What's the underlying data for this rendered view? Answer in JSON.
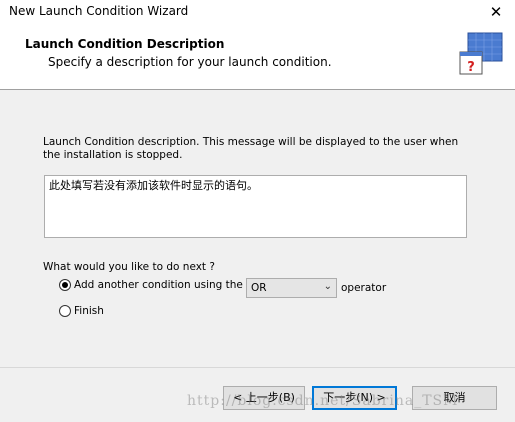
{
  "window": {
    "title": "New Launch Condition Wizard",
    "close_glyph": "✕"
  },
  "header": {
    "title": "Launch Condition Description",
    "subtitle": "Specify a description for your launch condition.",
    "icon": "wizard-help-icon"
  },
  "description": {
    "label": "Launch Condition description. This message will be displayed to the user when the installation is stopped.",
    "value": "此处填写若没有添加该软件时显示的语句。"
  },
  "next_step": {
    "label": "What would you like to do next ?",
    "options": [
      {
        "label": "Add another condition using the",
        "selected": true
      },
      {
        "label": "Finish",
        "selected": false
      }
    ],
    "operator": {
      "value": "OR",
      "suffix": "operator"
    }
  },
  "buttons": {
    "back": "< 上一步(B)",
    "next": "下一步(N) >",
    "cancel": "取消"
  },
  "watermark": "http://blog.csdn.net/Sabrina_TSM",
  "colors": {
    "accent": "#0078d7",
    "icon_blue": "#4a7bd0",
    "icon_red": "#d32020"
  }
}
